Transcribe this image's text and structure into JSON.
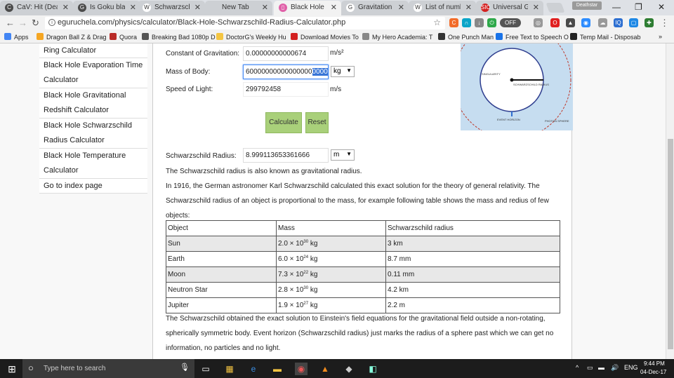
{
  "tabs": [
    {
      "label": "CaV: Hit (Dea",
      "icon": "cav-icon",
      "color": "#4b4b4b",
      "glyph": "C"
    },
    {
      "label": "Is Goku black",
      "icon": "site-icon",
      "color": "#4b4b4b",
      "glyph": "G"
    },
    {
      "label": "Schwarzschild",
      "icon": "wikipedia-icon",
      "color": "#ffffff",
      "glyph": "W"
    },
    {
      "label": "New Tab",
      "icon": "",
      "color": "",
      "glyph": ""
    },
    {
      "label": "Black Hole Sc",
      "icon": "bookmark-icon",
      "color": "#e060a8",
      "glyph": "▯"
    },
    {
      "label": "Gravitation Ca",
      "icon": "google-icon",
      "color": "#ffffff",
      "glyph": "G"
    },
    {
      "label": "List of numbe",
      "icon": "wikipedia-icon",
      "color": "#ffffff",
      "glyph": "W"
    },
    {
      "label": "Universal Gra",
      "icon": "sic-icon",
      "color": "#d32020",
      "glyph": "SIC"
    }
  ],
  "profile_label": "Deathstar",
  "address": "eguruchela.com/physics/calculator/Black-Hole-Schwarzschild-Radius-Calculator.php",
  "extensions": [
    {
      "name": "honey-icon",
      "color": "#f26c2a",
      "glyph": "C"
    },
    {
      "name": "headphones-icon",
      "color": "#0aa5c8",
      "glyph": "∩"
    },
    {
      "name": "download-icon",
      "color": "#888888",
      "glyph": "↓"
    },
    {
      "name": "power-icon",
      "color": "#2ea84a",
      "glyph": "⏻"
    },
    {
      "name": "toggle-icon",
      "color": "#555555",
      "glyph": "OFF"
    },
    {
      "name": "circle-icon",
      "color": "#999999",
      "glyph": "◎"
    },
    {
      "name": "opera-icon",
      "color": "#e02020",
      "glyph": "O"
    },
    {
      "name": "shield-icon",
      "color": "#4a4a4a",
      "glyph": "▲"
    },
    {
      "name": "zoom-icon",
      "color": "#2d8cff",
      "glyph": "◉"
    },
    {
      "name": "cloud-icon",
      "color": "#999999",
      "glyph": "☁"
    },
    {
      "name": "iq-icon",
      "color": "#2d6fd1",
      "glyph": "IQ"
    },
    {
      "name": "square-icon",
      "color": "#1e88e5",
      "glyph": "▢"
    },
    {
      "name": "puzzle-icon",
      "color": "#2e7d32",
      "glyph": "✚"
    }
  ],
  "bookmarks": [
    {
      "label": "Apps",
      "icon": "apps-icon",
      "color": "#4285f4"
    },
    {
      "label": "Dragon Ball Z & Drag",
      "icon": "dragonball-icon",
      "color": "#f5a623"
    },
    {
      "label": "Quora",
      "icon": "quora-icon",
      "color": "#b92b27"
    },
    {
      "label": "Breaking Bad 1080p D",
      "icon": "film-icon",
      "color": "#555555"
    },
    {
      "label": "DoctorG's Weekly Hu",
      "icon": "folder-icon",
      "color": "#f4c542"
    },
    {
      "label": "Download Movies To",
      "icon": "x-icon",
      "color": "#d32020"
    },
    {
      "label": "My Hero Academia: T",
      "icon": "globe-icon",
      "color": "#888888"
    },
    {
      "label": "One Punch Man",
      "icon": "ninja-icon",
      "color": "#333333"
    },
    {
      "label": "Free Text to Speech O",
      "icon": "n-icon",
      "color": "#1a73e8"
    },
    {
      "label": "Temp Mail - Disposab",
      "icon": "mail-icon",
      "color": "#222222"
    }
  ],
  "bookmarks_more": "»",
  "sidebar": [
    "Ring Calculator",
    "Black Hole Evaporation Time Calculator",
    "Black Hole Gravitational Redshift Calculator",
    "Black Hole Schwarzschild Radius Calculator",
    "Black Hole Temperature Calculator",
    "Go to index page"
  ],
  "form": {
    "gravitation_label": "Constant of Gravitation:",
    "gravitation_value": "0.00000000000674",
    "gravitation_unit": "m/s²",
    "mass_label": "Mass of Body:",
    "mass_value_plain": "60000000000000000",
    "mass_value_selected": "000000",
    "mass_unit": "kg",
    "light_label": "Speed of Light:",
    "light_value": "299792458",
    "light_unit": "m/s",
    "calculate_label": "Calculate",
    "reset_label": "Reset",
    "result_label": "Schwarzschild Radius:",
    "result_value": "8.999113653361666",
    "result_unit": "m"
  },
  "diagram": {
    "singularity": "SINGULARITY",
    "radius": "SCHWARZSCHILD RADIUS",
    "horizon": "EVENT HORIZON",
    "photon": "PHOTON SPHERE"
  },
  "text": {
    "p1": "The Schwarzschild radius is also known as gravitational radius.",
    "p2": "In 1916, the German astronomer Karl Schwarzschild calculated this exact solution for the theory of general relativity. The Schwarzschild radius of an object is proportional to the mass, for example following table shows the mass and redius of few objects:",
    "p3": "The Schwarzschild obtained the exact solution to Einstein's field equations for the gravitational field outside a non-rotating, spherically symmetric body. Event horizon (Schwarzschild radius) just marks the radius of a sphere past which we can get no information, no particles and no light."
  },
  "table": {
    "headers": [
      "Object",
      "Mass",
      "Schwarzschild radius"
    ],
    "rows": [
      {
        "object": "Sun",
        "mass_base": "2.0 × 10",
        "mass_exp": "30",
        "mass_unit": " kg",
        "radius": "3 km"
      },
      {
        "object": "Earth",
        "mass_base": "6.0 × 10",
        "mass_exp": "24",
        "mass_unit": " kg",
        "radius": "8.7 mm"
      },
      {
        "object": "Moon",
        "mass_base": "7.3 × 10",
        "mass_exp": "22",
        "mass_unit": " kg",
        "radius": "0.11 mm"
      },
      {
        "object": "Neutron Star",
        "mass_base": "2.8 × 10",
        "mass_exp": "30",
        "mass_unit": " kg",
        "radius": "4.2 km"
      },
      {
        "object": "Jupiter",
        "mass_base": "1.9 × 10",
        "mass_exp": "27",
        "mass_unit": " kg",
        "radius": "2.2 m"
      }
    ]
  },
  "taskbar": {
    "search_placeholder": "Type here to search",
    "lang": "ENG",
    "time": "9:44 PM",
    "date": "04-Dec-17"
  }
}
